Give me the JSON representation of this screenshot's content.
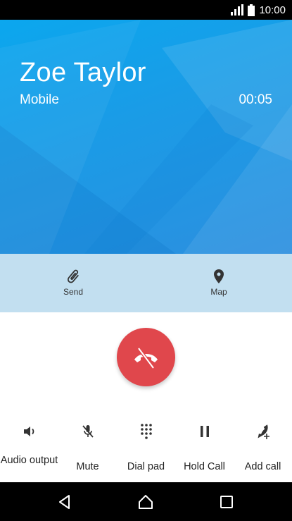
{
  "status_bar": {
    "time": "10:00",
    "icons": [
      "signal-icon",
      "battery-icon"
    ]
  },
  "call": {
    "contact_name": "Zoe Taylor",
    "number_type": "Mobile",
    "duration": "00:05"
  },
  "actions": [
    {
      "label": "Send",
      "icon": "paperclip-icon"
    },
    {
      "label": "Map",
      "icon": "location-pin-icon"
    }
  ],
  "end_call": {
    "icon": "end-call-icon",
    "color": "#e0474c"
  },
  "controls": [
    {
      "label": "Audio output",
      "icon": "speaker-icon"
    },
    {
      "label": "Mute",
      "icon": "mic-off-icon"
    },
    {
      "label": "Dial pad",
      "icon": "dialpad-icon"
    },
    {
      "label": "Hold Call",
      "icon": "pause-icon"
    },
    {
      "label": "Add call",
      "icon": "add-call-icon"
    }
  ],
  "nav": [
    "back-icon",
    "home-icon",
    "recents-icon"
  ],
  "colors": {
    "hero": "#1b9be6",
    "strip": "#c2dff0",
    "end_call": "#e0474c"
  }
}
